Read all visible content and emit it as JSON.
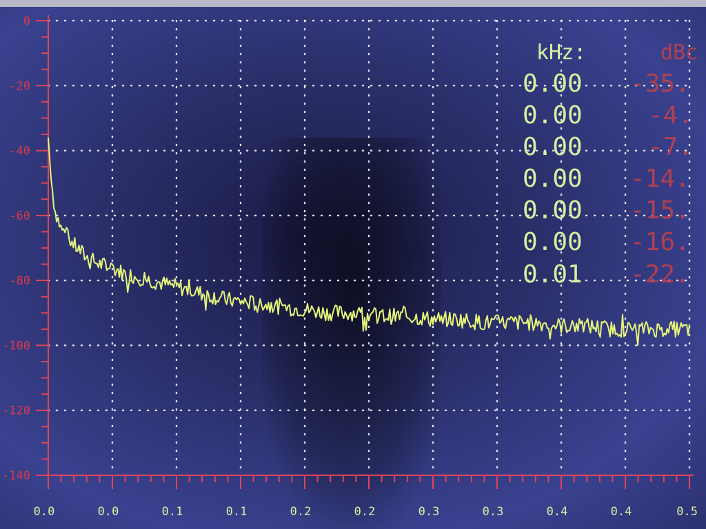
{
  "chart_data": {
    "type": "line",
    "y_ticks": [
      "0",
      "-20",
      "-40",
      "-60",
      "-80",
      "-100",
      "-120",
      "-140"
    ],
    "x_ticks": [
      "0.0",
      "0.0",
      "0.1",
      "0.1",
      "0.2",
      "0.2",
      "0.3",
      "0.3",
      "0.4",
      "0.4",
      "0.5"
    ],
    "ylim": [
      -140,
      0
    ],
    "xlim": [
      0,
      0.5
    ],
    "grid": true,
    "series": [
      {
        "color": "#e6f57a",
        "x": [
          0.0,
          0.002,
          0.005,
          0.01,
          0.02,
          0.03,
          0.04,
          0.05,
          0.06,
          0.08,
          0.1,
          0.12,
          0.14,
          0.16,
          0.18,
          0.2,
          0.22,
          0.24,
          0.26,
          0.28,
          0.3,
          0.32,
          0.34,
          0.36,
          0.38,
          0.4,
          0.42,
          0.44,
          0.46,
          0.48,
          0.5
        ],
        "y": [
          -36,
          -48,
          -58,
          -64,
          -69,
          -73,
          -75,
          -76,
          -78,
          -80,
          -82,
          -84,
          -86,
          -87,
          -88,
          -89,
          -90,
          -90,
          -91,
          -91,
          -92,
          -92,
          -93,
          -93,
          -93,
          -94,
          -94,
          -95,
          -95,
          -95,
          -95
        ]
      }
    ]
  },
  "peak_table": {
    "freq_header": "kHz:",
    "db_header": "dBc",
    "rows": [
      {
        "freq": "0.00",
        "db": "-35."
      },
      {
        "freq": "0.00",
        "db": "-4."
      },
      {
        "freq": "0.00",
        "db": "-7."
      },
      {
        "freq": "0.00",
        "db": "-14."
      },
      {
        "freq": "0.00",
        "db": "-15."
      },
      {
        "freq": "0.00",
        "db": "-16."
      },
      {
        "freq": "0.01",
        "db": "-22."
      }
    ]
  }
}
